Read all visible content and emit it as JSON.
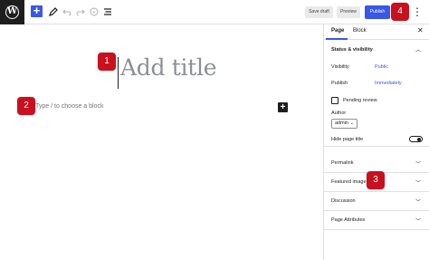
{
  "toolbar": {
    "save_draft_label": "Save draft",
    "preview_label": "Preview",
    "publish_label": "Publish",
    "logo_letter": "W",
    "add_symbol": "+",
    "more_symbol": "⋮"
  },
  "editor": {
    "title_placeholder": "Add title",
    "block_placeholder": "Type / to choose a block",
    "inline_add_symbol": "+"
  },
  "sidebar": {
    "tabs": [
      {
        "label": "Page"
      },
      {
        "label": "Block"
      }
    ],
    "close_symbol": "✕",
    "status": {
      "title": "Status & visibility",
      "visibility_label": "Visibility",
      "visibility_value": "Public",
      "publish_label": "Publish",
      "publish_value": "Immediately",
      "pending_review_label": "Pending review",
      "author_label": "Author",
      "author_value": "admin",
      "hide_title_label": "Hide page title"
    },
    "sections": [
      {
        "title": "Permalink"
      },
      {
        "title": "Featured image"
      },
      {
        "title": "Discussion"
      },
      {
        "title": "Page Attributes"
      }
    ]
  },
  "markers": [
    "1",
    "2",
    "3",
    "4"
  ],
  "colors": {
    "accent": "#3858e9",
    "marker": "#c8101f",
    "dark": "#1e1e1e"
  }
}
